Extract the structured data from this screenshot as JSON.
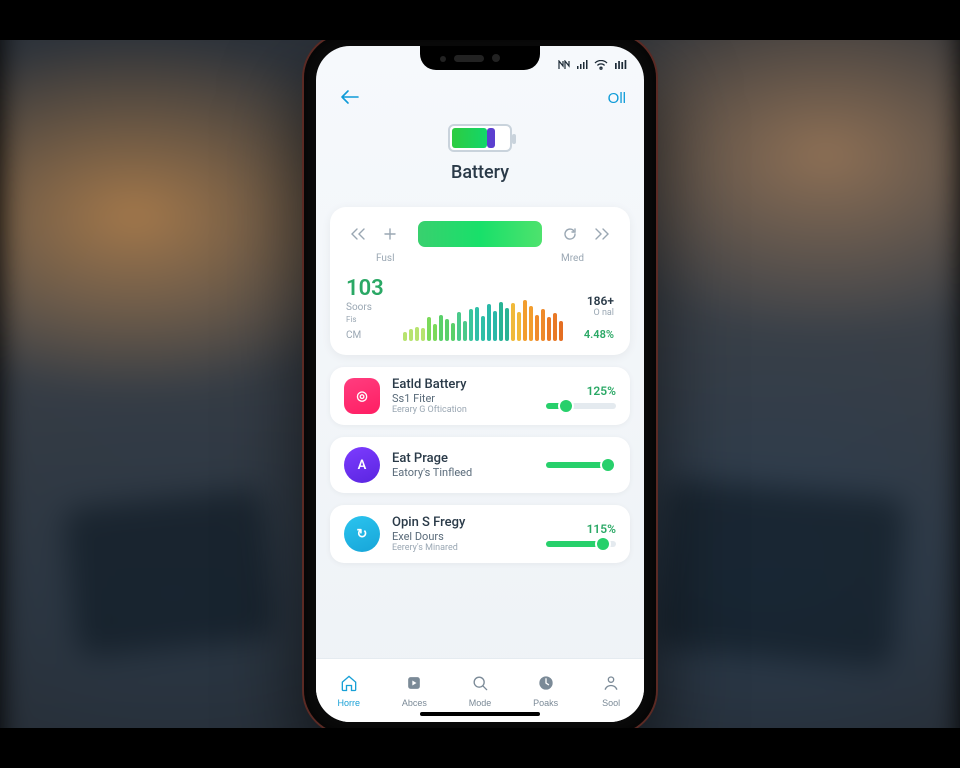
{
  "header": {
    "action_label": "Oll"
  },
  "hero": {
    "title": "Battery"
  },
  "card": {
    "label_left": "Fusl",
    "label_right": "Mred",
    "stat_big": "103",
    "stat_big_sub": "Soors",
    "stat_big_sub2": "Fis",
    "stat_cm": "CM",
    "stat_r1": "186+",
    "stat_r2": "O nal",
    "stat_r3": "4.48%"
  },
  "chart_data": {
    "type": "bar",
    "categories": [],
    "values": [
      14,
      18,
      22,
      20,
      36,
      26,
      40,
      34,
      28,
      44,
      30,
      48,
      52,
      38,
      56,
      46,
      60,
      50,
      58,
      44,
      62,
      54,
      40,
      48,
      36,
      42,
      30
    ],
    "colors": [
      "#b7e36f",
      "#b7e36f",
      "#b7e36f",
      "#b7e36f",
      "#7bd95a",
      "#7bd95a",
      "#5ad06a",
      "#5ad06a",
      "#5ad06a",
      "#4ac98a",
      "#4ac98a",
      "#3bc59c",
      "#2fbfa7",
      "#2fbfa7",
      "#2ab8a8",
      "#2ab8a8",
      "#29b394",
      "#29b394",
      "#f0b93a",
      "#f0b93a",
      "#f29d2e",
      "#f29d2e",
      "#ef8a2a",
      "#ef8a2a",
      "#e97926",
      "#e97926",
      "#e46e22"
    ],
    "title": "",
    "xlabel": "",
    "ylabel": "",
    "ylim": [
      0,
      70
    ]
  },
  "list": [
    {
      "icon": "◎",
      "icon_style": "pink",
      "title": "Eatld Battery",
      "sub1": "Ss1 Fiter",
      "sub2": "Eerary G Oftication",
      "pct": "125%",
      "slider": 28
    },
    {
      "icon": "A",
      "icon_style": "purple",
      "title": "Eat Prage",
      "sub1": "Eatory's Tinfleed",
      "sub2": "",
      "pct": "",
      "slider": 88
    },
    {
      "icon": "↻",
      "icon_style": "cyan",
      "title": "Opin S Fregy",
      "sub1": "Exel Dours",
      "sub2": "Eerery's Minared",
      "pct": "115%",
      "slider": 82
    }
  ],
  "tabs": [
    {
      "label": "Horre",
      "active": true
    },
    {
      "label": "Abces",
      "active": false
    },
    {
      "label": "Mode",
      "active": false
    },
    {
      "label": "Poaks",
      "active": false
    },
    {
      "label": "Sool",
      "active": false
    }
  ]
}
